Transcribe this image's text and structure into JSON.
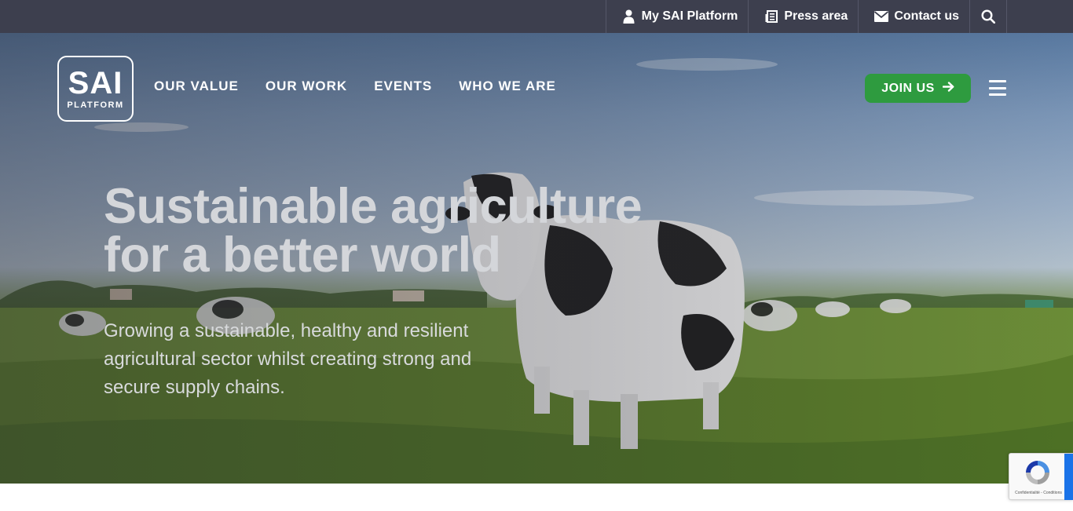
{
  "topbar": {
    "links": [
      {
        "label": "My SAI Platform",
        "icon": "user-icon"
      },
      {
        "label": "Press area",
        "icon": "newspaper-icon"
      },
      {
        "label": "Contact us",
        "icon": "envelope-icon"
      }
    ],
    "search_icon": "search-icon"
  },
  "logo": {
    "main": "SAI",
    "sub": "PLATFORM"
  },
  "nav": {
    "items": [
      "OUR VALUE",
      "OUR WORK",
      "EVENTS",
      "WHO WE ARE"
    ],
    "join_label": "JOIN US",
    "menu_icon": "hamburger-menu-icon"
  },
  "hero": {
    "title_line1": "Sustainable agriculture",
    "title_line2": "for a better world",
    "subtitle": "Growing a sustainable, healthy and resilient agricultural sector whilst creating strong and secure supply chains."
  },
  "recaptcha": {
    "text": "Confidentialité - Conditions"
  },
  "colors": {
    "topbar_bg": "#3d3f4e",
    "join_button": "#2e9b3f",
    "recaptcha_blue": "#1a73e8"
  }
}
